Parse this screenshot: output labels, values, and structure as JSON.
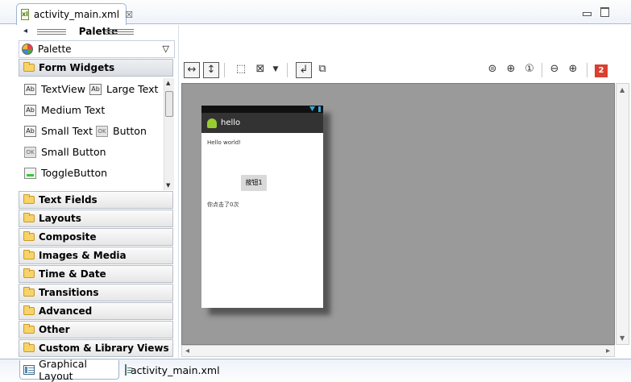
{
  "editor": {
    "tab_label": "activity_main.xml",
    "tab_close": "☒",
    "file_badge": "xl"
  },
  "palette": {
    "title": "Palette",
    "dropdown_value": "Palette",
    "categories": [
      {
        "label": "Form Widgets",
        "expanded": true
      },
      {
        "label": "Text Fields"
      },
      {
        "label": "Layouts"
      },
      {
        "label": "Composite"
      },
      {
        "label": "Images & Media"
      },
      {
        "label": "Time & Date"
      },
      {
        "label": "Transitions"
      },
      {
        "label": "Advanced"
      },
      {
        "label": "Other"
      },
      {
        "label": "Custom & Library Views"
      }
    ],
    "widgets": {
      "textview": "TextView",
      "large_text": "Large Text",
      "medium_text": "Medium Text",
      "small_text": "Small Text",
      "button": "Button",
      "small_button": "Small Button",
      "toggle_button": "ToggleButton",
      "ab_badge": "Ab",
      "ok_badge": "OK"
    }
  },
  "toolbar": {
    "error_count": "2"
  },
  "device": {
    "app_title": "hello",
    "hello_text": "Hello world!",
    "button_label": "按钮1",
    "click_text": "你点击了0次"
  },
  "bottom_tabs": {
    "graphical_layout": "Graphical Layout",
    "xml_source": "activity_main.xml"
  },
  "icons": {
    "collapse": "◂",
    "dropdown": "▽",
    "scroll_up": "▲",
    "scroll_down": "▼",
    "scroll_left": "◂",
    "scroll_right": "▸"
  },
  "colors": {
    "canvas": "#9a9a9a",
    "action_bar": "#333333",
    "error_badge": "#d8402f",
    "tab_border": "#a8bbd5"
  }
}
